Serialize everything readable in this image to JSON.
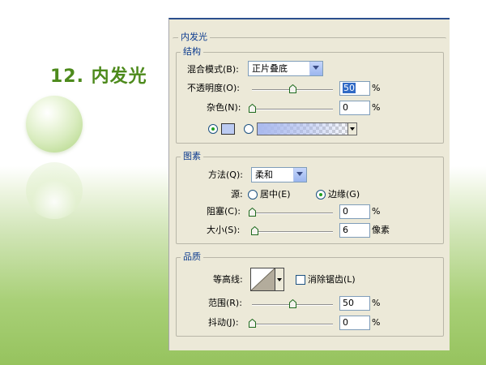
{
  "slide": {
    "title": "12. 内发光"
  },
  "panel": {
    "title": "内发光",
    "structure": {
      "legend": "结构",
      "blend_mode_label": "混合模式(B):",
      "blend_mode_value": "正片叠底",
      "opacity_label": "不透明度(O):",
      "opacity_value": "50",
      "opacity_unit": "%",
      "opacity_level_percent": 50,
      "noise_label": "杂色(N):",
      "noise_value": "0",
      "noise_unit": "%",
      "noise_level_percent": 0,
      "color_option_selected": "solid",
      "swatch_color": "#bccbf2"
    },
    "elements": {
      "legend": "图素",
      "method_label": "方法(Q):",
      "method_value": "柔和",
      "source_label": "源:",
      "source_center_label": "居中(E)",
      "source_edge_label": "边缘(G)",
      "source_selected": "edge",
      "choke_label": "阻塞(C):",
      "choke_value": "0",
      "choke_unit": "%",
      "choke_level_percent": 0,
      "size_label": "大小(S):",
      "size_value": "6",
      "size_unit": "像素",
      "size_level_percent": 3
    },
    "quality": {
      "legend": "品质",
      "contour_label": "等高线:",
      "antialias_label": "消除锯齿(L)",
      "antialias_checked": false,
      "range_label": "范围(R):",
      "range_value": "50",
      "range_unit": "%",
      "range_level_percent": 50,
      "jitter_label": "抖动(J):",
      "jitter_value": "0",
      "jitter_unit": "%",
      "jitter_level_percent": 0
    }
  },
  "icons": {
    "select_arrow": "chevron-down-icon",
    "slider_thumb": "slider-thumb-icon",
    "contour_curve": "linear-contour-icon"
  }
}
